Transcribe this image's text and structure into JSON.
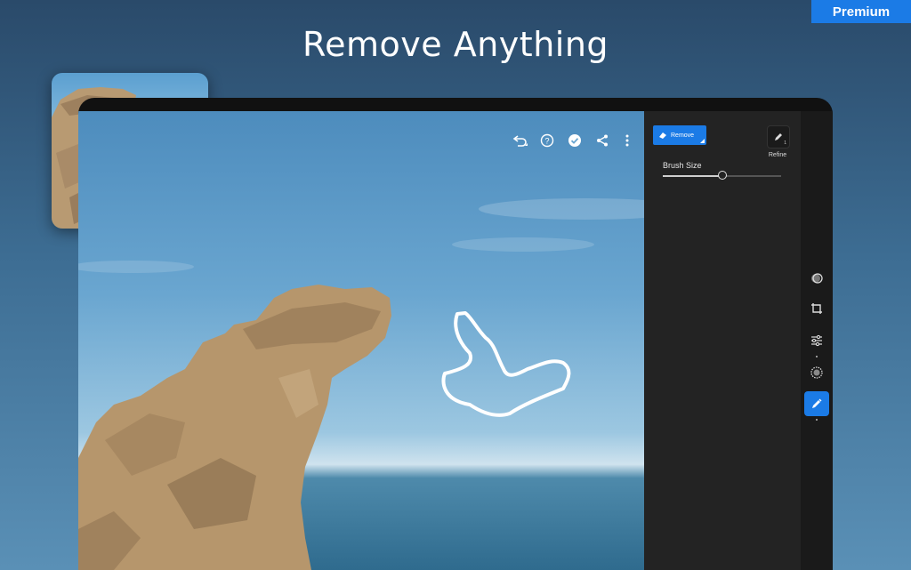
{
  "banner": {
    "premium_label": "Premium",
    "headline": "Remove Anything"
  },
  "toolbar": {
    "icons": [
      "undo-icon",
      "help-icon",
      "done-check-icon",
      "share-icon",
      "more-vertical-icon"
    ]
  },
  "panel": {
    "remove_label": "Remove",
    "refine_label": "Refine",
    "refine_badge": "1",
    "brush_size_label": "Brush Size",
    "brush_size_level": 0.5
  },
  "rail": {
    "icons": [
      "looks-icon",
      "crop-icon",
      "adjustments-icon",
      "effects-icon",
      "heal-brush-icon"
    ],
    "active": "heal-brush-icon"
  },
  "colors": {
    "accent": "#1b7be6",
    "panel": "#232323",
    "rail": "#1a1a1a"
  }
}
